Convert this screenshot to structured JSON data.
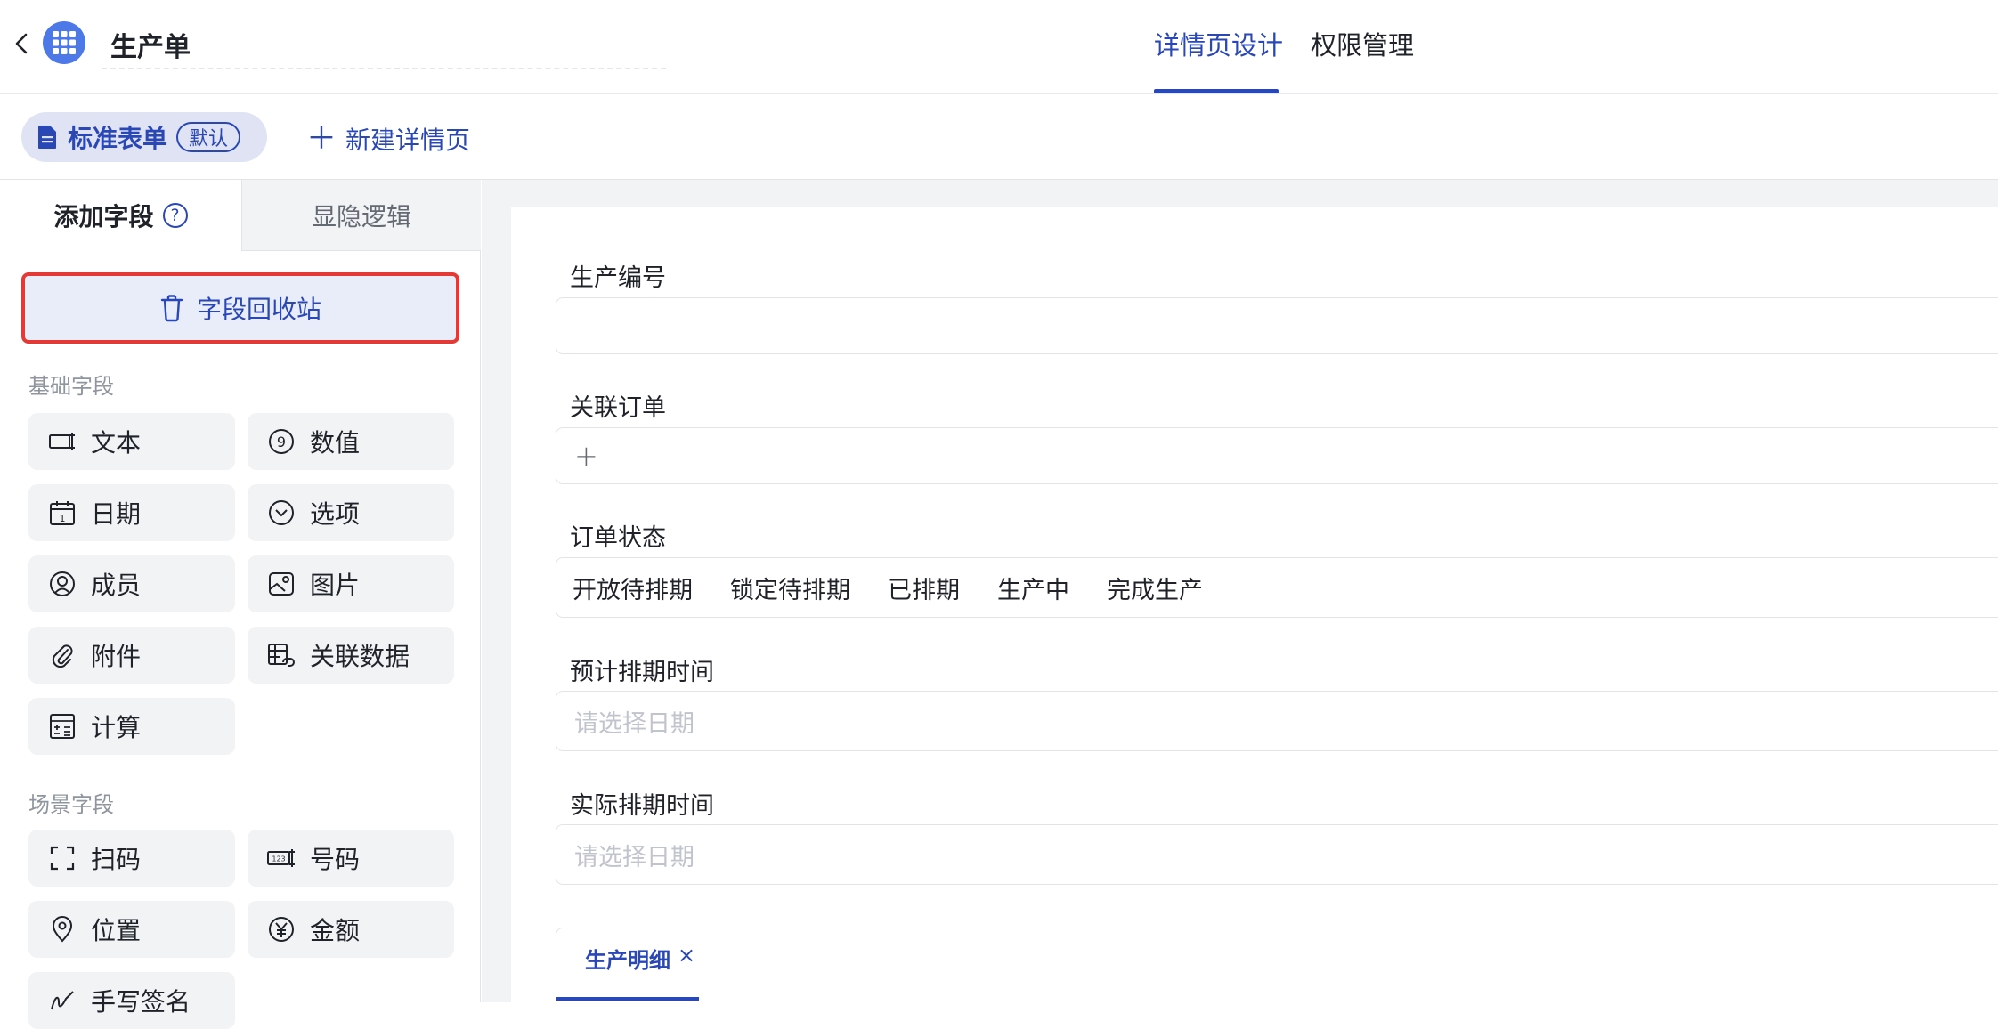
{
  "header": {
    "title": "生产单",
    "tabs": [
      {
        "label": "详情页设计",
        "active": true
      },
      {
        "label": "权限管理",
        "active": false
      }
    ]
  },
  "toolbar": {
    "standard_form": "标准表单",
    "default_badge": "默认",
    "new_detail_page": "新建详情页"
  },
  "left_panel": {
    "tabs": [
      {
        "label": "添加字段",
        "active": true
      },
      {
        "label": "显隐逻辑",
        "active": false
      }
    ],
    "help_glyph": "?",
    "recycle_bin": "字段回收站",
    "basic_section": "基础字段",
    "basic_fields": [
      {
        "label": "文本",
        "icon": "text-field-icon"
      },
      {
        "label": "数值",
        "icon": "number-icon"
      },
      {
        "label": "日期",
        "icon": "calendar-icon"
      },
      {
        "label": "选项",
        "icon": "dropdown-icon"
      },
      {
        "label": "成员",
        "icon": "member-icon"
      },
      {
        "label": "图片",
        "icon": "image-icon"
      },
      {
        "label": "附件",
        "icon": "paperclip-icon"
      },
      {
        "label": "关联数据",
        "icon": "linked-data-icon"
      },
      {
        "label": "计算",
        "icon": "calculator-icon"
      }
    ],
    "scene_section": "场景字段",
    "scene_fields": [
      {
        "label": "扫码",
        "icon": "scan-icon"
      },
      {
        "label": "号码",
        "icon": "number-code-icon"
      },
      {
        "label": "位置",
        "icon": "location-icon"
      },
      {
        "label": "金额",
        "icon": "currency-yuan-icon"
      },
      {
        "label": "手写签名",
        "icon": "signature-icon"
      }
    ]
  },
  "form": {
    "fields": [
      {
        "label": "生产编号",
        "type": "text",
        "value": ""
      },
      {
        "label": "关联订单",
        "type": "relation",
        "add_glyph": "+"
      },
      {
        "label": "订单状态",
        "type": "options",
        "options": [
          "开放待排期",
          "锁定待排期",
          "已排期",
          "生产中",
          "完成生产"
        ]
      },
      {
        "label": "预计排期时间",
        "type": "date",
        "placeholder": "请选择日期"
      },
      {
        "label": "实际排期时间",
        "type": "date",
        "placeholder": "请选择日期"
      }
    ],
    "sub_table": {
      "tab_label": "生产明细",
      "close_glyph": "×"
    }
  },
  "colors": {
    "accent": "#2947b5",
    "app_icon": "#4d78e8",
    "highlight_border": "#e53935",
    "canvas_bg": "#f2f3f5"
  }
}
